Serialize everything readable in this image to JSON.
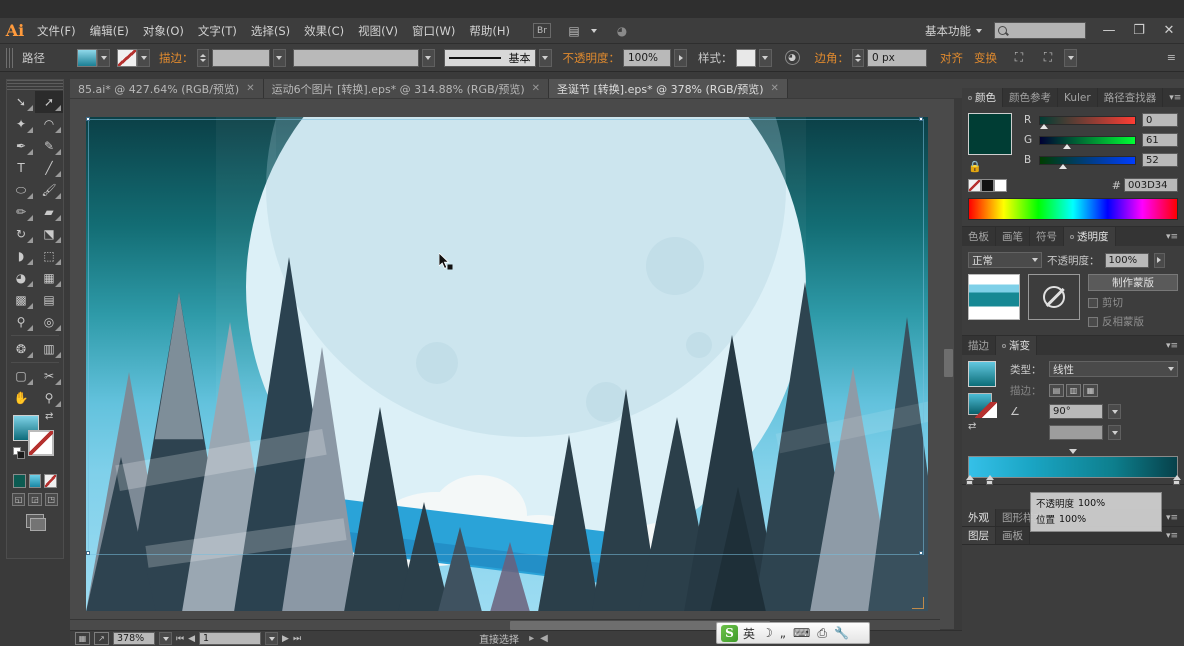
{
  "app": {
    "logo": "Ai",
    "workspace": "基本功能",
    "search_placeholder": ""
  },
  "menu": {
    "items": [
      {
        "label": "文件(F)"
      },
      {
        "label": "编辑(E)"
      },
      {
        "label": "对象(O)"
      },
      {
        "label": "文字(T)"
      },
      {
        "label": "选择(S)"
      },
      {
        "label": "效果(C)"
      },
      {
        "label": "视图(V)"
      },
      {
        "label": "窗口(W)"
      },
      {
        "label": "帮助(H)"
      }
    ]
  },
  "window_buttons": {
    "minimize": "—",
    "restore": "❐",
    "close": "✕"
  },
  "control_bar": {
    "object_label": "路径",
    "stroke_weight_value": "",
    "stroke_profile_value": "",
    "brush_label": "基本",
    "opacity_label": "不透明度：",
    "opacity_value": "100%",
    "style_label": "样式：",
    "corner_label": "边角：",
    "corner_value": "0 px",
    "align_label": "对齐",
    "transform_label": "变换",
    "isolate_label": "",
    "fill_color": "#3fb8d6",
    "stroke_color": "none"
  },
  "doc_tabs": [
    {
      "label": "85.ai* @ 427.64% (RGB/预览)",
      "close": "✕",
      "active": false
    },
    {
      "label": "运动6个图片 [转换].eps* @ 314.88% (RGB/预览)",
      "close": "✕",
      "active": false
    },
    {
      "label": "圣诞节 [转换].eps* @ 378% (RGB/预览)",
      "close": "✕",
      "active": true
    }
  ],
  "toolbar": {
    "tools": [
      {
        "name": "selection-tool",
        "glyph": "↖"
      },
      {
        "name": "direct-selection-tool",
        "glyph": "↖",
        "active": true
      },
      {
        "name": "magic-wand-tool",
        "glyph": "✦"
      },
      {
        "name": "lasso-tool",
        "glyph": "◌"
      },
      {
        "name": "pen-tool",
        "glyph": "✒"
      },
      {
        "name": "add-anchor-point-tool",
        "glyph": "✒"
      },
      {
        "name": "type-tool",
        "glyph": "T"
      },
      {
        "name": "line-segment-tool",
        "glyph": "╱"
      },
      {
        "name": "ellipse-tool",
        "glyph": "⬭"
      },
      {
        "name": "paintbrush-tool",
        "glyph": "✎"
      },
      {
        "name": "pencil-tool",
        "glyph": "✏"
      },
      {
        "name": "blob-brush-tool",
        "glyph": "▰"
      },
      {
        "name": "rotate-tool",
        "glyph": "↻"
      },
      {
        "name": "scale-tool",
        "glyph": "◱"
      },
      {
        "name": "width-tool",
        "glyph": "◗"
      },
      {
        "name": "free-transform-tool",
        "glyph": "⬚"
      },
      {
        "name": "shape-builder-tool",
        "glyph": "◔"
      },
      {
        "name": "column-graph-tool",
        "glyph": "█"
      },
      {
        "name": "mesh-tool",
        "glyph": "⌗"
      },
      {
        "name": "gradient-tool",
        "glyph": "▤"
      },
      {
        "name": "eyedropper-tool",
        "glyph": "⚗"
      },
      {
        "name": "blend-tool",
        "glyph": "◎"
      },
      {
        "name": "symbol-sprayer-tool",
        "glyph": "❂"
      },
      {
        "name": "graph-tool",
        "glyph": "█"
      },
      {
        "name": "artboard-tool",
        "glyph": "▢"
      },
      {
        "name": "slice-tool",
        "glyph": "✂"
      },
      {
        "name": "hand-tool",
        "glyph": "✋"
      },
      {
        "name": "zoom-tool",
        "glyph": "⚲"
      }
    ]
  },
  "canvas": {
    "zoom_label": "378%",
    "artboard_index": "1",
    "status_tool": "直接选择",
    "scene": {
      "title": "Winter night forest illustration",
      "sky_top": "#0b4047",
      "sky_bottom": "#9ddcf2",
      "moon_color": "#dcf0f7",
      "tree_dark": "#2b3f4a",
      "tree_teal": "#1d6a73",
      "tree_light": "#9aa8b4",
      "river_color": "#2aa3d8",
      "cloud_color": "#f4f8f8"
    }
  },
  "status_bar": {
    "zoom_value": "378%",
    "artboard_value": "1",
    "tool_label": "直接选择"
  },
  "color_panel": {
    "tabs": [
      {
        "label": "颜色",
        "active": true
      },
      {
        "label": "颜色参考",
        "active": false
      },
      {
        "label": "Kuler",
        "active": false
      },
      {
        "label": "路径查找器",
        "active": false
      }
    ],
    "channels": [
      {
        "label": "R",
        "value": "0"
      },
      {
        "label": "G",
        "value": "61"
      },
      {
        "label": "B",
        "value": "52"
      }
    ],
    "hex_label": "#",
    "hex_value": "003D34",
    "swatch_color": "#003d34"
  },
  "transparency_panel": {
    "tabs": [
      {
        "label": "色板",
        "active": false
      },
      {
        "label": "画笔",
        "active": false
      },
      {
        "label": "符号",
        "active": false
      },
      {
        "label": "透明度",
        "active": true
      }
    ],
    "blend_mode": "正常",
    "opacity_label": "不透明度：",
    "opacity_value": "100%",
    "make_mask_label": "制作蒙版",
    "clip_label": "剪切",
    "invert_label": "反相蒙版"
  },
  "gradient_panel": {
    "tabs": [
      {
        "label": "描边",
        "active": false
      },
      {
        "label": "渐变",
        "active": true
      }
    ],
    "type_label": "类型：",
    "type_value": "线性",
    "stroke_label": "描边：",
    "angle_label": "∠",
    "angle_value": "90°",
    "aspect_label": "",
    "aspect_value": "",
    "stop_opacity_label": "不透明度",
    "stop_opacity_value": "100%",
    "stop_location_label": "位置",
    "stop_location_value": "100%"
  },
  "bottom_panels": [
    {
      "tabs": [
        {
          "label": "外观",
          "active": true
        },
        {
          "label": "图形样式",
          "active": false
        }
      ]
    },
    {
      "tabs": [
        {
          "label": "图层",
          "active": true
        },
        {
          "label": "画板",
          "active": false
        }
      ]
    }
  ],
  "ime_bar": {
    "logo": "S",
    "mode": "英",
    "items": [
      "☽",
      "„",
      "⌨",
      "⎙",
      "🔧"
    ]
  }
}
